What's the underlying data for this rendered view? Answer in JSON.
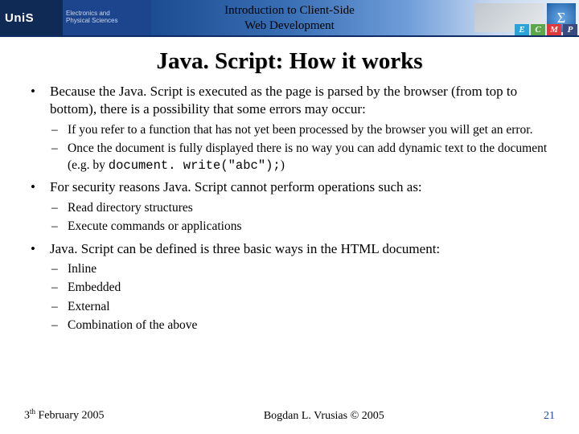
{
  "header": {
    "logo_text": "UniS",
    "sub_logo_line1": "Electronics and",
    "sub_logo_line2": "Physical Sciences",
    "course_line1": "Introduction to Client-Side",
    "course_line2": "Web Development",
    "sigma": "Σ",
    "ecmp": {
      "e": "E",
      "c": "C",
      "m": "M",
      "p": "P"
    }
  },
  "title": "Java. Script: How it works",
  "bullets": {
    "b1": "Because the Java. Script is executed as the page is parsed by the browser (from top to bottom), there is a possibility that some errors may occur:",
    "b1_sub": {
      "s1": "If you refer to a function that has not yet been processed by the browser you will get an error.",
      "s2_a": "Once the document is fully displayed there is no way you can add dynamic text to the document (e.g. by ",
      "s2_code": "document. write(\"abc\");",
      "s2_b": ")"
    },
    "b2": "For security reasons Java. Script cannot perform operations such as:",
    "b2_sub": {
      "s1": "Read directory structures",
      "s2": "Execute commands or applications"
    },
    "b3": "Java. Script can be defined is three basic ways in the HTML document:",
    "b3_sub": {
      "s1": "Inline",
      "s2": "Embedded",
      "s3": "External",
      "s4": "Combination of the above"
    }
  },
  "footer": {
    "date_day": "3",
    "date_suffix": "th",
    "date_rest": " February 2005",
    "author": "Bogdan L. Vrusias © 2005",
    "page": "21"
  }
}
